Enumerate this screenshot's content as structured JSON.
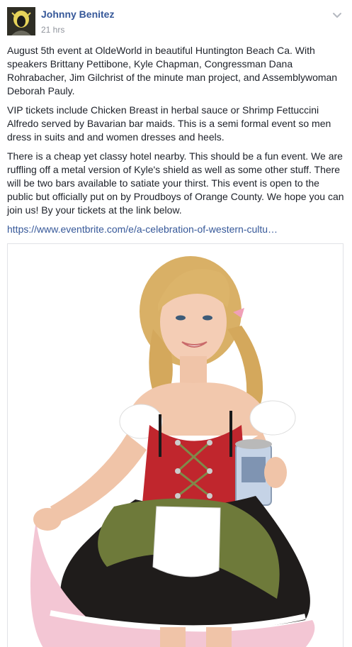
{
  "post": {
    "author": "Johnny Benitez",
    "time": "21 hrs",
    "paragraphs": [
      "August 5th event at OldeWorld in beautiful Huntington Beach Ca. With speakers Brittany Pettibone, Kyle Chapman, Congressman Dana Rohrabacher, Jim Gilchrist of the minute man project, and Assemblywoman Deborah Pauly.",
      "VIP tickets include Chicken Breast in herbal sauce or Shrimp Fettuccini Alfredo served by Bavarian bar maids. This is a semi formal event so men dress in suits and and women dresses and heels.",
      "There is a cheap yet classy hotel nearby. This should be a fun event. We are ruffling off a metal version of Kyle's shield as well as some other stuff. There will be two bars available to satiate your thirst. This event is open to the public but officially put on by Proudboys of Orange County. We hope you can join us! By your tickets at the link below."
    ],
    "link": "https://www.eventbrite.com/e/a-celebration-of-western-cultu…"
  },
  "icons": {
    "options": "chevron-down-icon"
  },
  "colors": {
    "author": "#365899",
    "link": "#365899",
    "meta": "#90949c",
    "text": "#1d2129"
  }
}
